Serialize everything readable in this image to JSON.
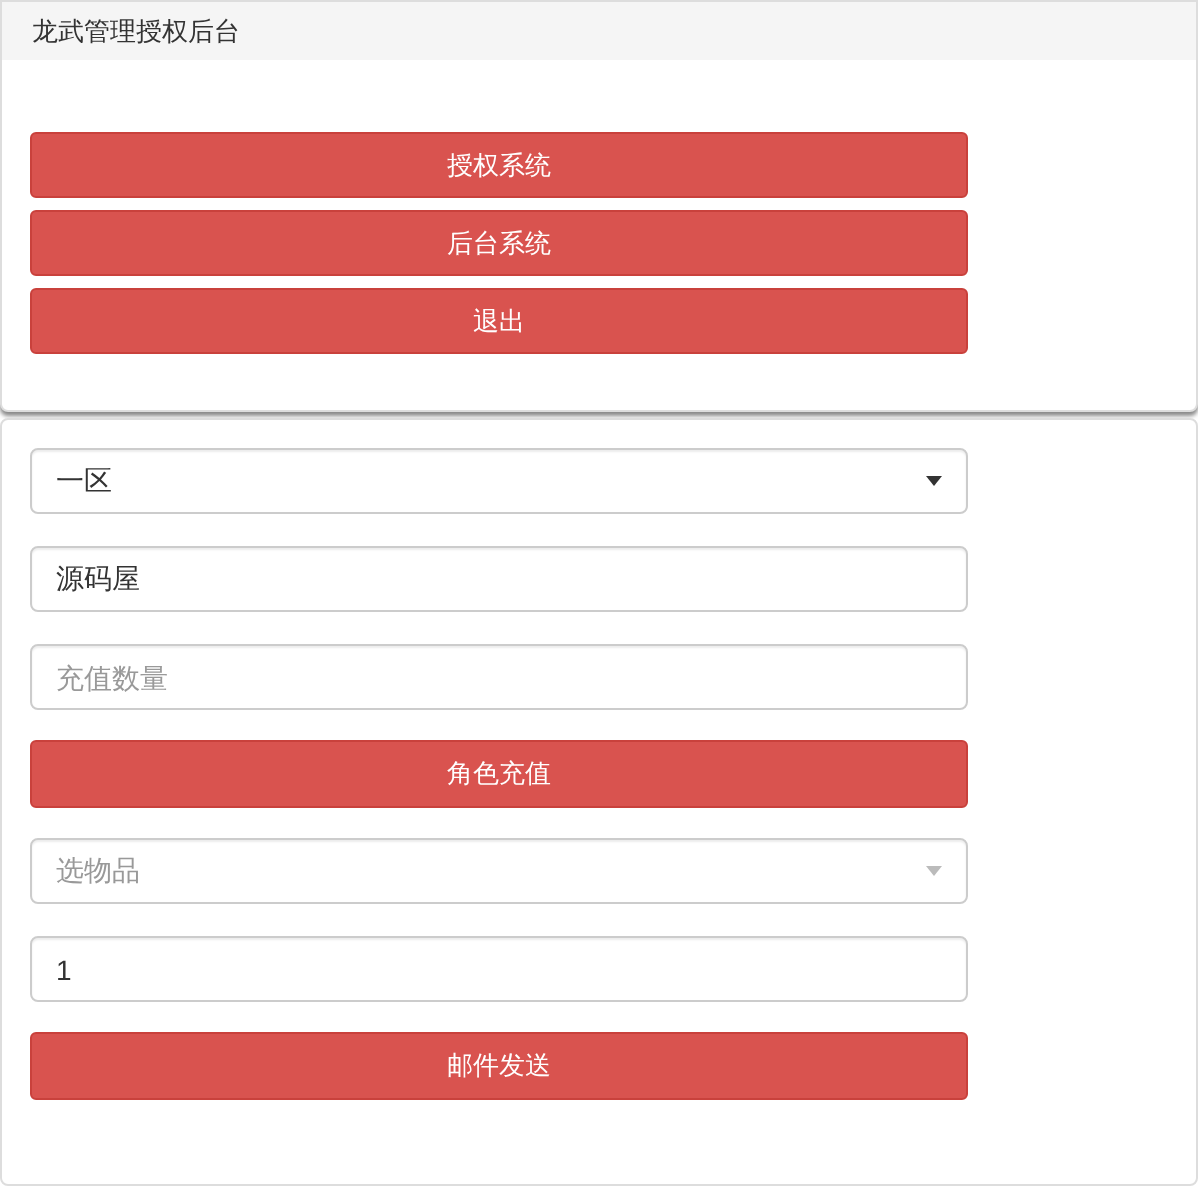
{
  "header": {
    "title": "龙武管理授权后台"
  },
  "menu_buttons": [
    "授权系统",
    "后台系统",
    "退出"
  ],
  "form": [
    {
      "kind": "select",
      "value": "一区"
    },
    {
      "kind": "input",
      "value": "源码屋"
    },
    {
      "kind": "input",
      "placeholder": "充值数量"
    },
    {
      "kind": "button",
      "label": "角色充值"
    },
    {
      "kind": "select",
      "placeholder": "选物品"
    },
    {
      "kind": "input",
      "value": "1"
    },
    {
      "kind": "button",
      "label": "邮件发送"
    }
  ]
}
